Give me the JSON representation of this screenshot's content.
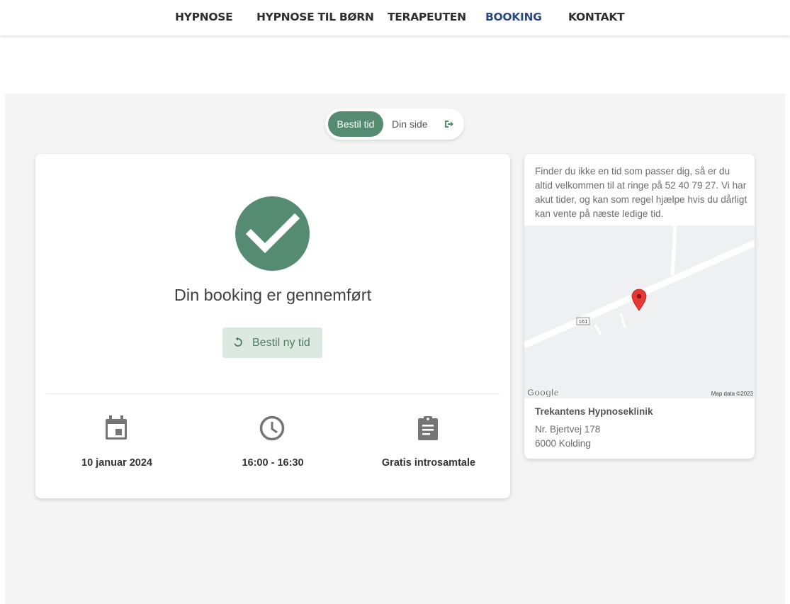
{
  "nav": {
    "items": [
      {
        "label": "HYPNOSE",
        "active": false
      },
      {
        "label": "HYPNOSE TIL BØRN",
        "active": false
      },
      {
        "label": "TERAPEUTEN",
        "active": false
      },
      {
        "label": "BOOKING",
        "active": true
      },
      {
        "label": "KONTAKT",
        "active": false
      }
    ]
  },
  "toggle": {
    "book_label": "Bestil tid",
    "my_page_label": "Din side",
    "logout_icon": "logout-icon"
  },
  "booking": {
    "status_icon": "check-circle-icon",
    "title": "Din booking er gennemført",
    "rebook_label": "Bestil ny tid",
    "rebook_icon": "refresh-icon",
    "date": "10 januar 2024",
    "date_icon": "calendar-icon",
    "time": "16:00 - 16:30",
    "time_icon": "clock-icon",
    "service": "Gratis introsamtale",
    "service_icon": "clipboard-icon"
  },
  "sidebar": {
    "info_text": "Finder du ikke en tid som passer dig, så er du altid velkommen til at ringe på 52 40 79 27. Vi har akut tider, og kan som regel hjælpe hvis du dårligt kan vente på næste ledige tid.",
    "map": {
      "road_label": "161",
      "provider_logo": "Google",
      "attribution": "Map data ©2023"
    },
    "clinic_name": "Trekantens Hypnoseklinik",
    "address_line1": "Nr. Bjertvej 178",
    "address_line2": "6000 Kolding"
  },
  "colors": {
    "accent": "#558b70",
    "accent_light": "#dce9e1",
    "nav_active": "#2c4a7a",
    "page_bg": "#f4f4f4",
    "map_pin": "#e53935"
  }
}
